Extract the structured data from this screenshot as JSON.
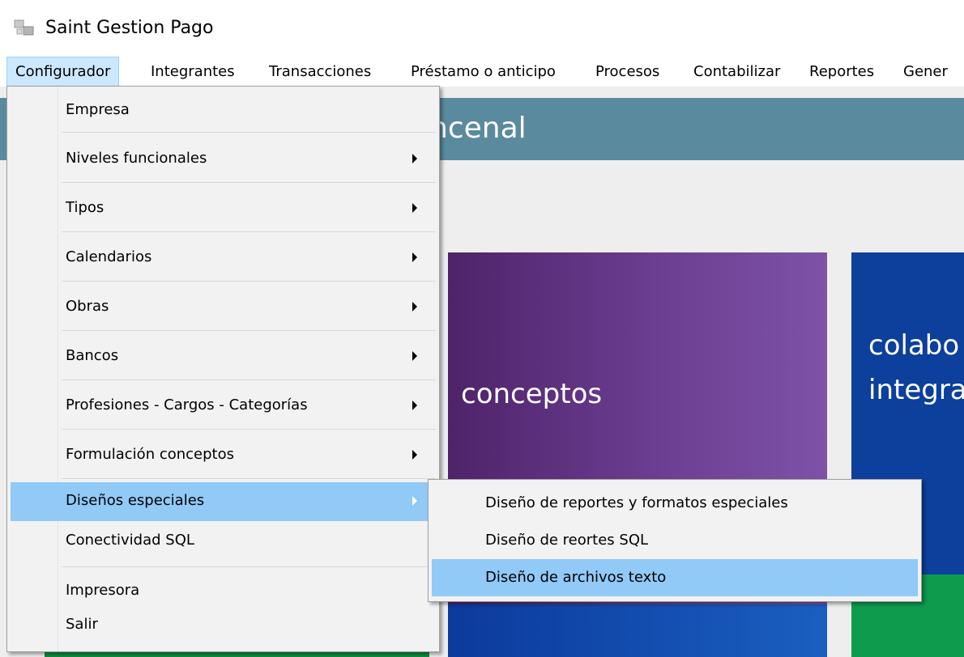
{
  "window": {
    "title": "Saint Gestion Pago",
    "icon": "app-icon"
  },
  "menubar": {
    "items": [
      "Configurador",
      "Integrantes",
      "Transacciones",
      "Préstamo o anticipo",
      "Procesos",
      "Contabilizar",
      "Reportes",
      "Gener"
    ],
    "active": "Configurador"
  },
  "background": {
    "banner_text": "ncenal",
    "tiles": [
      {
        "label": "conceptos"
      },
      {
        "label_line1": "colabo",
        "label_line2": "integra"
      }
    ]
  },
  "dropdown": {
    "items": [
      {
        "label": "Empresa",
        "submenu": false
      },
      {
        "label": "Niveles funcionales",
        "submenu": true
      },
      {
        "label": "Tipos",
        "submenu": true
      },
      {
        "label": "Calendarios",
        "submenu": true
      },
      {
        "label": "Obras",
        "submenu": true
      },
      {
        "label": "Bancos",
        "submenu": true
      },
      {
        "label": "Profesiones - Cargos - Categorías",
        "submenu": true
      },
      {
        "label": "Formulación conceptos",
        "submenu": true
      },
      {
        "label": "Diseños especiales",
        "submenu": true,
        "highlighted": true
      },
      {
        "label": "Conectividad SQL",
        "submenu": false
      },
      {
        "label": "Impresora",
        "submenu": false
      },
      {
        "label": "Salir",
        "submenu": false
      }
    ]
  },
  "submenu": {
    "items": [
      {
        "label": "Diseño de reportes y formatos especiales"
      },
      {
        "label": "Diseño de reortes SQL"
      },
      {
        "label": "Diseño de archivos texto",
        "highlighted": true
      }
    ]
  },
  "colors": {
    "highlight": "#91c9f7",
    "menubar_active": "#cce8ff",
    "banner": "#5a8a9e",
    "tile_purple": "#6b3e92",
    "tile_blue": "#0d3f9c",
    "tile_green": "#0e9b4e"
  }
}
